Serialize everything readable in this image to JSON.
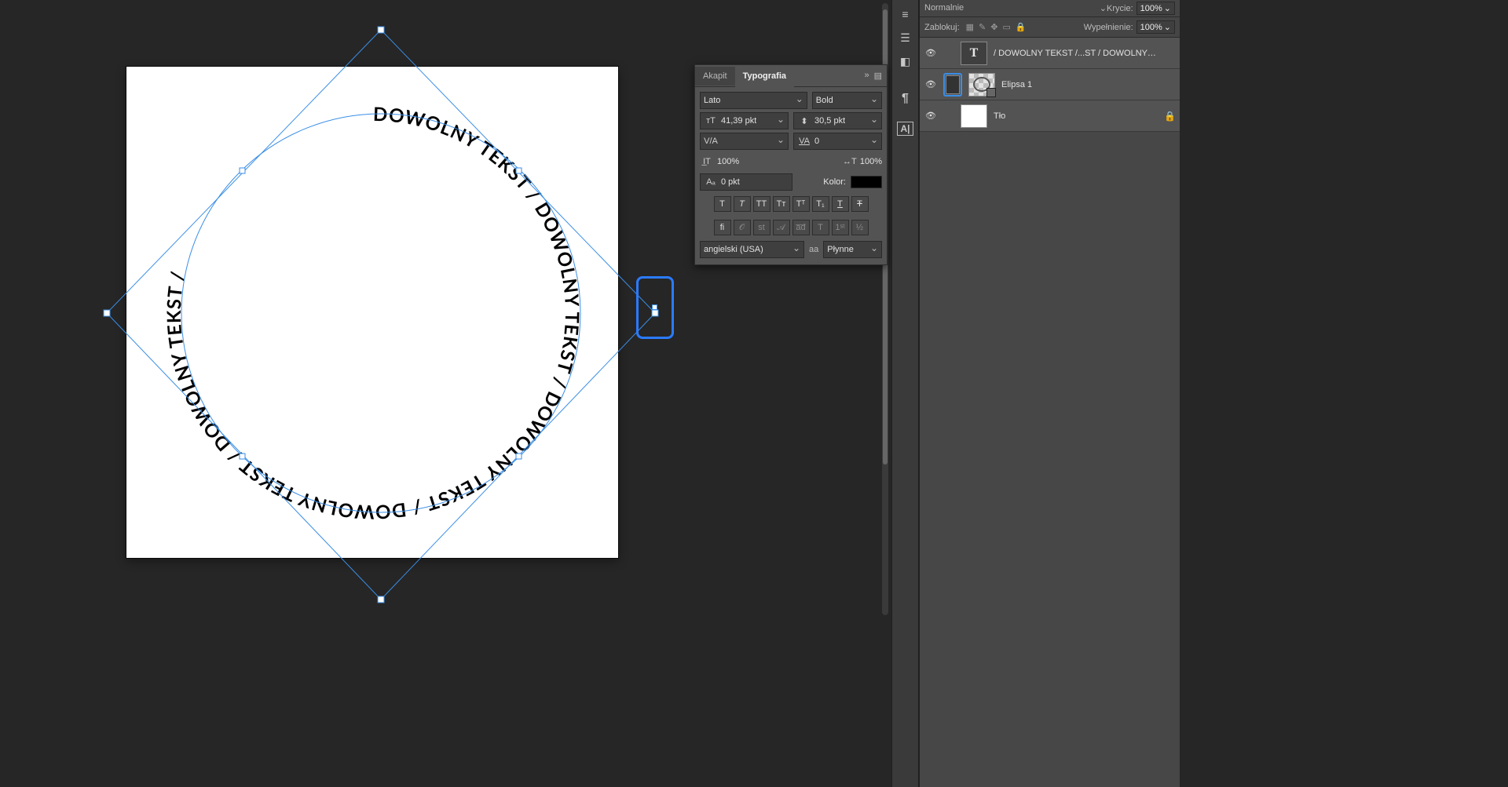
{
  "canvas": {
    "curved_text": "DOWOLNY TEKST / DOWOLNY TEKST / DOWOLNY TEKST / DOWOLNY TEKST / DOWOLNY TEKST / "
  },
  "typography_panel": {
    "tab_paragraph": "Akapit",
    "tab_character": "Typografia",
    "font_family": "Lato",
    "font_style": "Bold",
    "size": "41,39 pkt",
    "leading": "30,5 pkt",
    "kerning": "",
    "tracking": "0",
    "vscale": "100%",
    "hscale": "100%",
    "baseline": "0 pkt",
    "color_label": "Kolor:",
    "color_value": "#000000",
    "language": "angielski (USA)",
    "antialias_label": "aa",
    "antialias_value": "Płynne",
    "style_buttons": [
      "T",
      "T",
      "TT",
      "Tᴛ",
      "Tᵀ",
      "T₁",
      "T",
      "Ŧ"
    ],
    "feature_buttons": [
      "fi",
      "𝒪",
      "st",
      "𝒜",
      "a̅d̅",
      "T",
      "1ˢᵗ",
      "½"
    ]
  },
  "layers_panel": {
    "blend_mode": "Normalnie",
    "opacity_label": "Krycie:",
    "opacity_value": "100%",
    "lock_label": "Zablokuj:",
    "fill_label": "Wypełnienie:",
    "fill_value": "100%",
    "layers": [
      {
        "type": "text",
        "name": "/ DOWOLNY TEKST /...ST / DOWOLNY TEKS",
        "visible": true,
        "selected": false,
        "locked": false
      },
      {
        "type": "shape",
        "name": "Elipsa 1",
        "visible": true,
        "selected": true,
        "locked": false
      },
      {
        "type": "bg",
        "name": "Tło",
        "visible": true,
        "selected": false,
        "locked": true
      }
    ]
  }
}
